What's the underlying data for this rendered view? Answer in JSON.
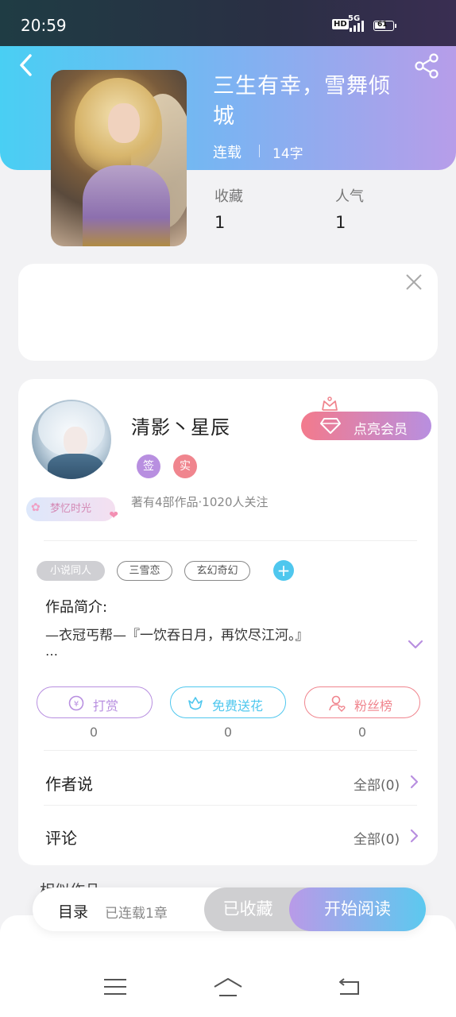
{
  "status_bar": {
    "time": "20:59",
    "hd": "HD",
    "network": "5G",
    "battery": "61"
  },
  "book": {
    "title": "三生有幸，雪舞倾城",
    "status": "连载",
    "word_count": "14字",
    "stats": [
      {
        "label": "收藏",
        "value": "1"
      },
      {
        "label": "人气",
        "value": "1"
      }
    ]
  },
  "author": {
    "name": "清影丶星辰",
    "badges": [
      "签",
      "实"
    ],
    "meta": "著有4部作品·1020人关注",
    "avatar_badge": "梦忆时光",
    "vip_button": "点亮会员"
  },
  "tags": [
    "小说同人",
    "三雪恋",
    "玄幻奇幻"
  ],
  "intro": {
    "label": "作品简介:",
    "text": "—衣冠丐帮—『一饮吞日月，再饮尽江河。』",
    "more": "…"
  },
  "actions": [
    {
      "label": "打赏",
      "count": "0",
      "color": "#b88fe0"
    },
    {
      "label": "免费送花",
      "count": "0",
      "color": "#4fc7ee"
    },
    {
      "label": "粉丝榜",
      "count": "0",
      "color": "#f0858e"
    }
  ],
  "rows": [
    {
      "label": "作者说",
      "right": "全部(0)"
    },
    {
      "label": "评论",
      "right": "全部(0)"
    }
  ],
  "similar_label": "相似作品",
  "bottom_bar": {
    "catalog": "目录",
    "chapters": "已连载1章",
    "collected": "已收藏",
    "read": "开始阅读"
  },
  "colors": {
    "header_gradient": [
      "#49cff3",
      "#b79de9"
    ],
    "accent_purple": "#b88fe0",
    "accent_blue": "#4fc7ee",
    "accent_pink": "#f0858e"
  }
}
